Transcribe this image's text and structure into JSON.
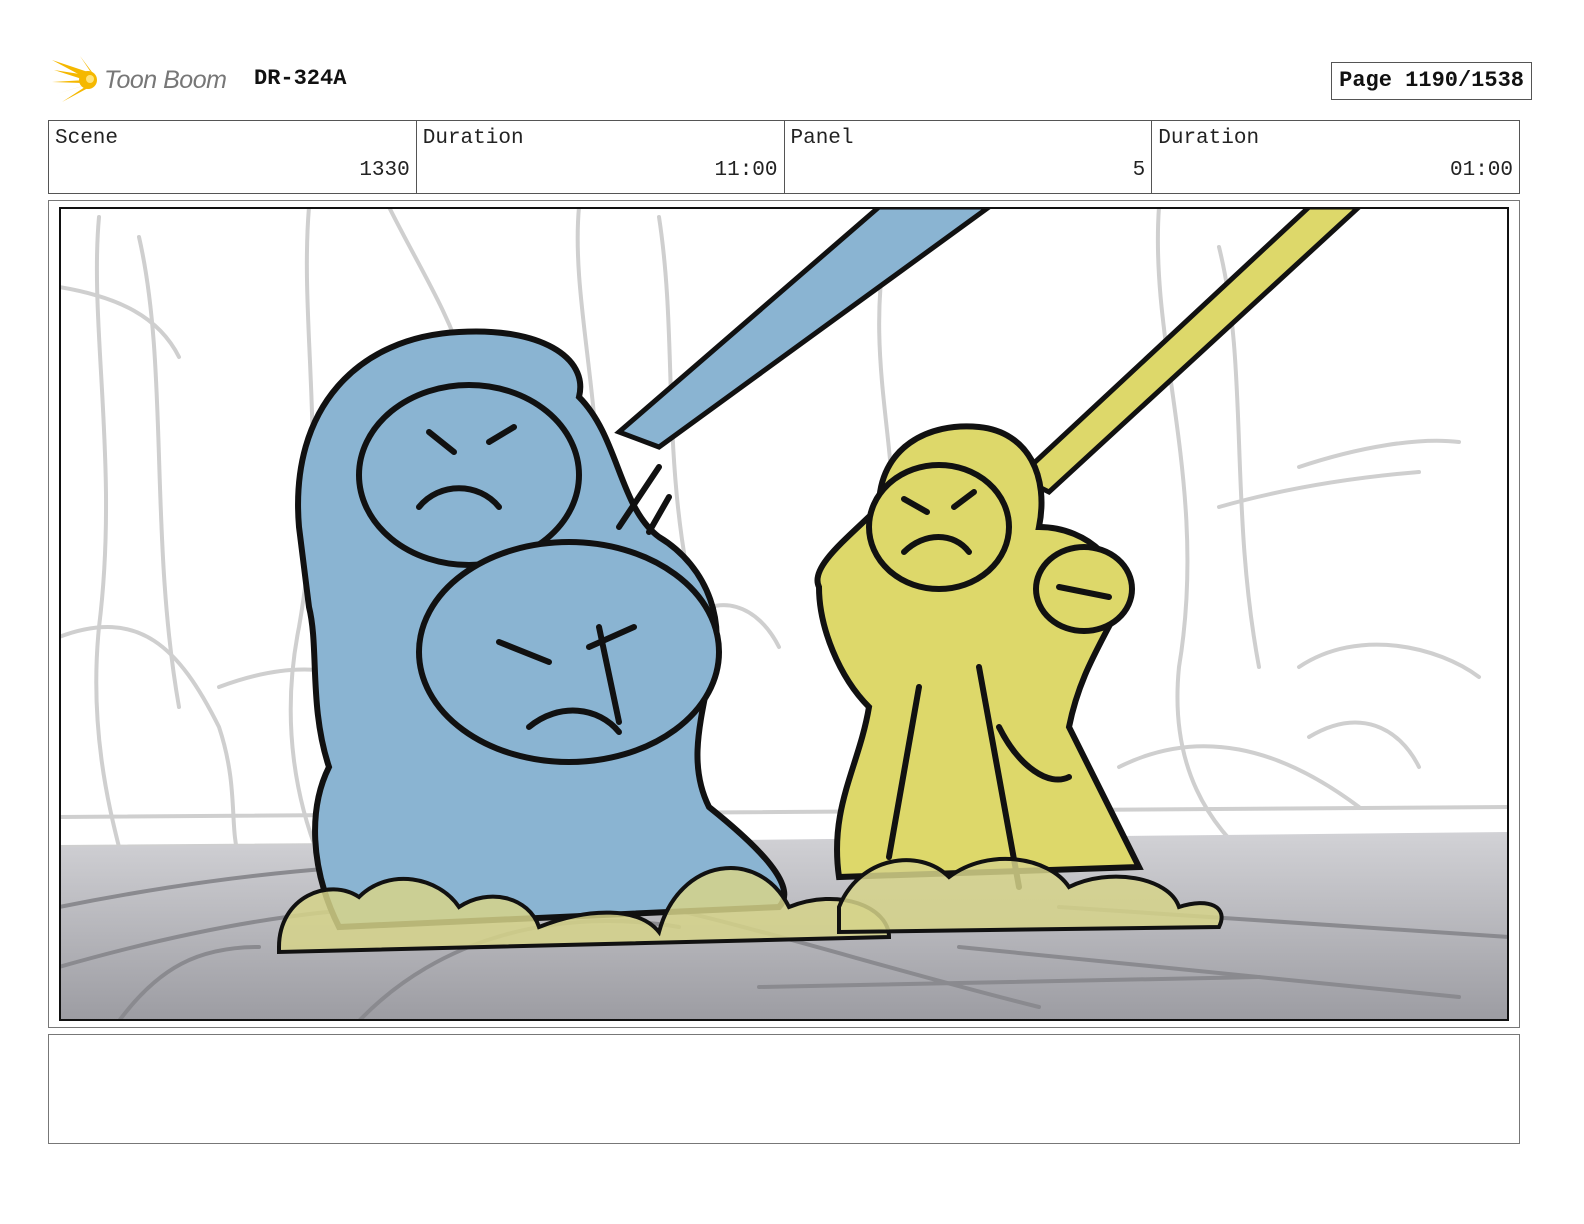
{
  "header": {
    "logo_text": "Toon Boom",
    "production_code": "DR-324A",
    "page_label": "Page 1190/1538"
  },
  "info": {
    "scene_label": "Scene",
    "scene_value": "1330",
    "scene_duration_label": "Duration",
    "scene_duration_value": "11:00",
    "panel_label": "Panel",
    "panel_value": "5",
    "panel_duration_label": "Duration",
    "panel_duration_value": "01:00"
  },
  "colors": {
    "logo_accent": "#f5b800",
    "blue_character": "#8ab4d2",
    "yellow_character": "#ddd86a",
    "sketch_gray": "#c8c8c8",
    "floor_gray": "#a8a8ad"
  },
  "notes": ""
}
